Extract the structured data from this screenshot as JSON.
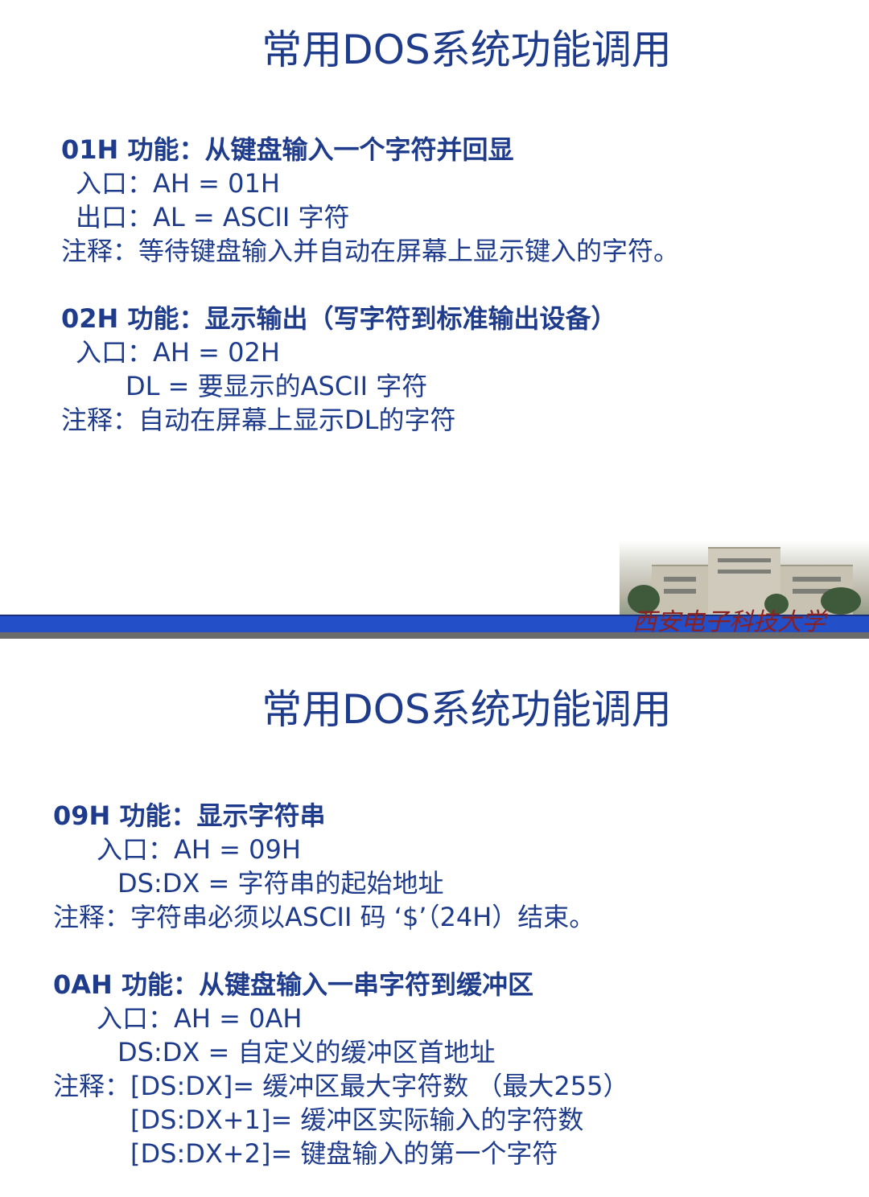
{
  "slide1": {
    "title": "常用DOS系统功能调用",
    "lines": [
      "01H 功能：从键盘输入一个字符并回显",
      "入口：AH = 01H",
      "出口：AL = ASCII 字符",
      "注释：等待键盘输入并自动在屏幕上显示键入的字符。",
      "02H 功能：显示输出（写字符到标准输出设备）",
      "入口：AH = 02H",
      "DL = 要显示的ASCII 字符",
      "注释：自动在屏幕上显示DL的字符"
    ],
    "university": "西安电子科技大学"
  },
  "slide2": {
    "title": "常用DOS系统功能调用",
    "lines": [
      "09H 功能：显示字符串",
      "入口：AH = 09H",
      "DS:DX = 字符串的起始地址",
      "注释：字符串必须以ASCII 码 ‘$’（24H）结束。",
      "0AH 功能：从键盘输入一串字符到缓冲区",
      "入口：AH = 0AH",
      "DS:DX = 自定义的缓冲区首地址",
      "注释：[DS:DX]= 缓冲区最大字符数 （最大255）",
      "[DS:DX+1]= 缓冲区实际输入的字符数",
      "[DS:DX+2]= 键盘输入的第一个字符"
    ]
  }
}
